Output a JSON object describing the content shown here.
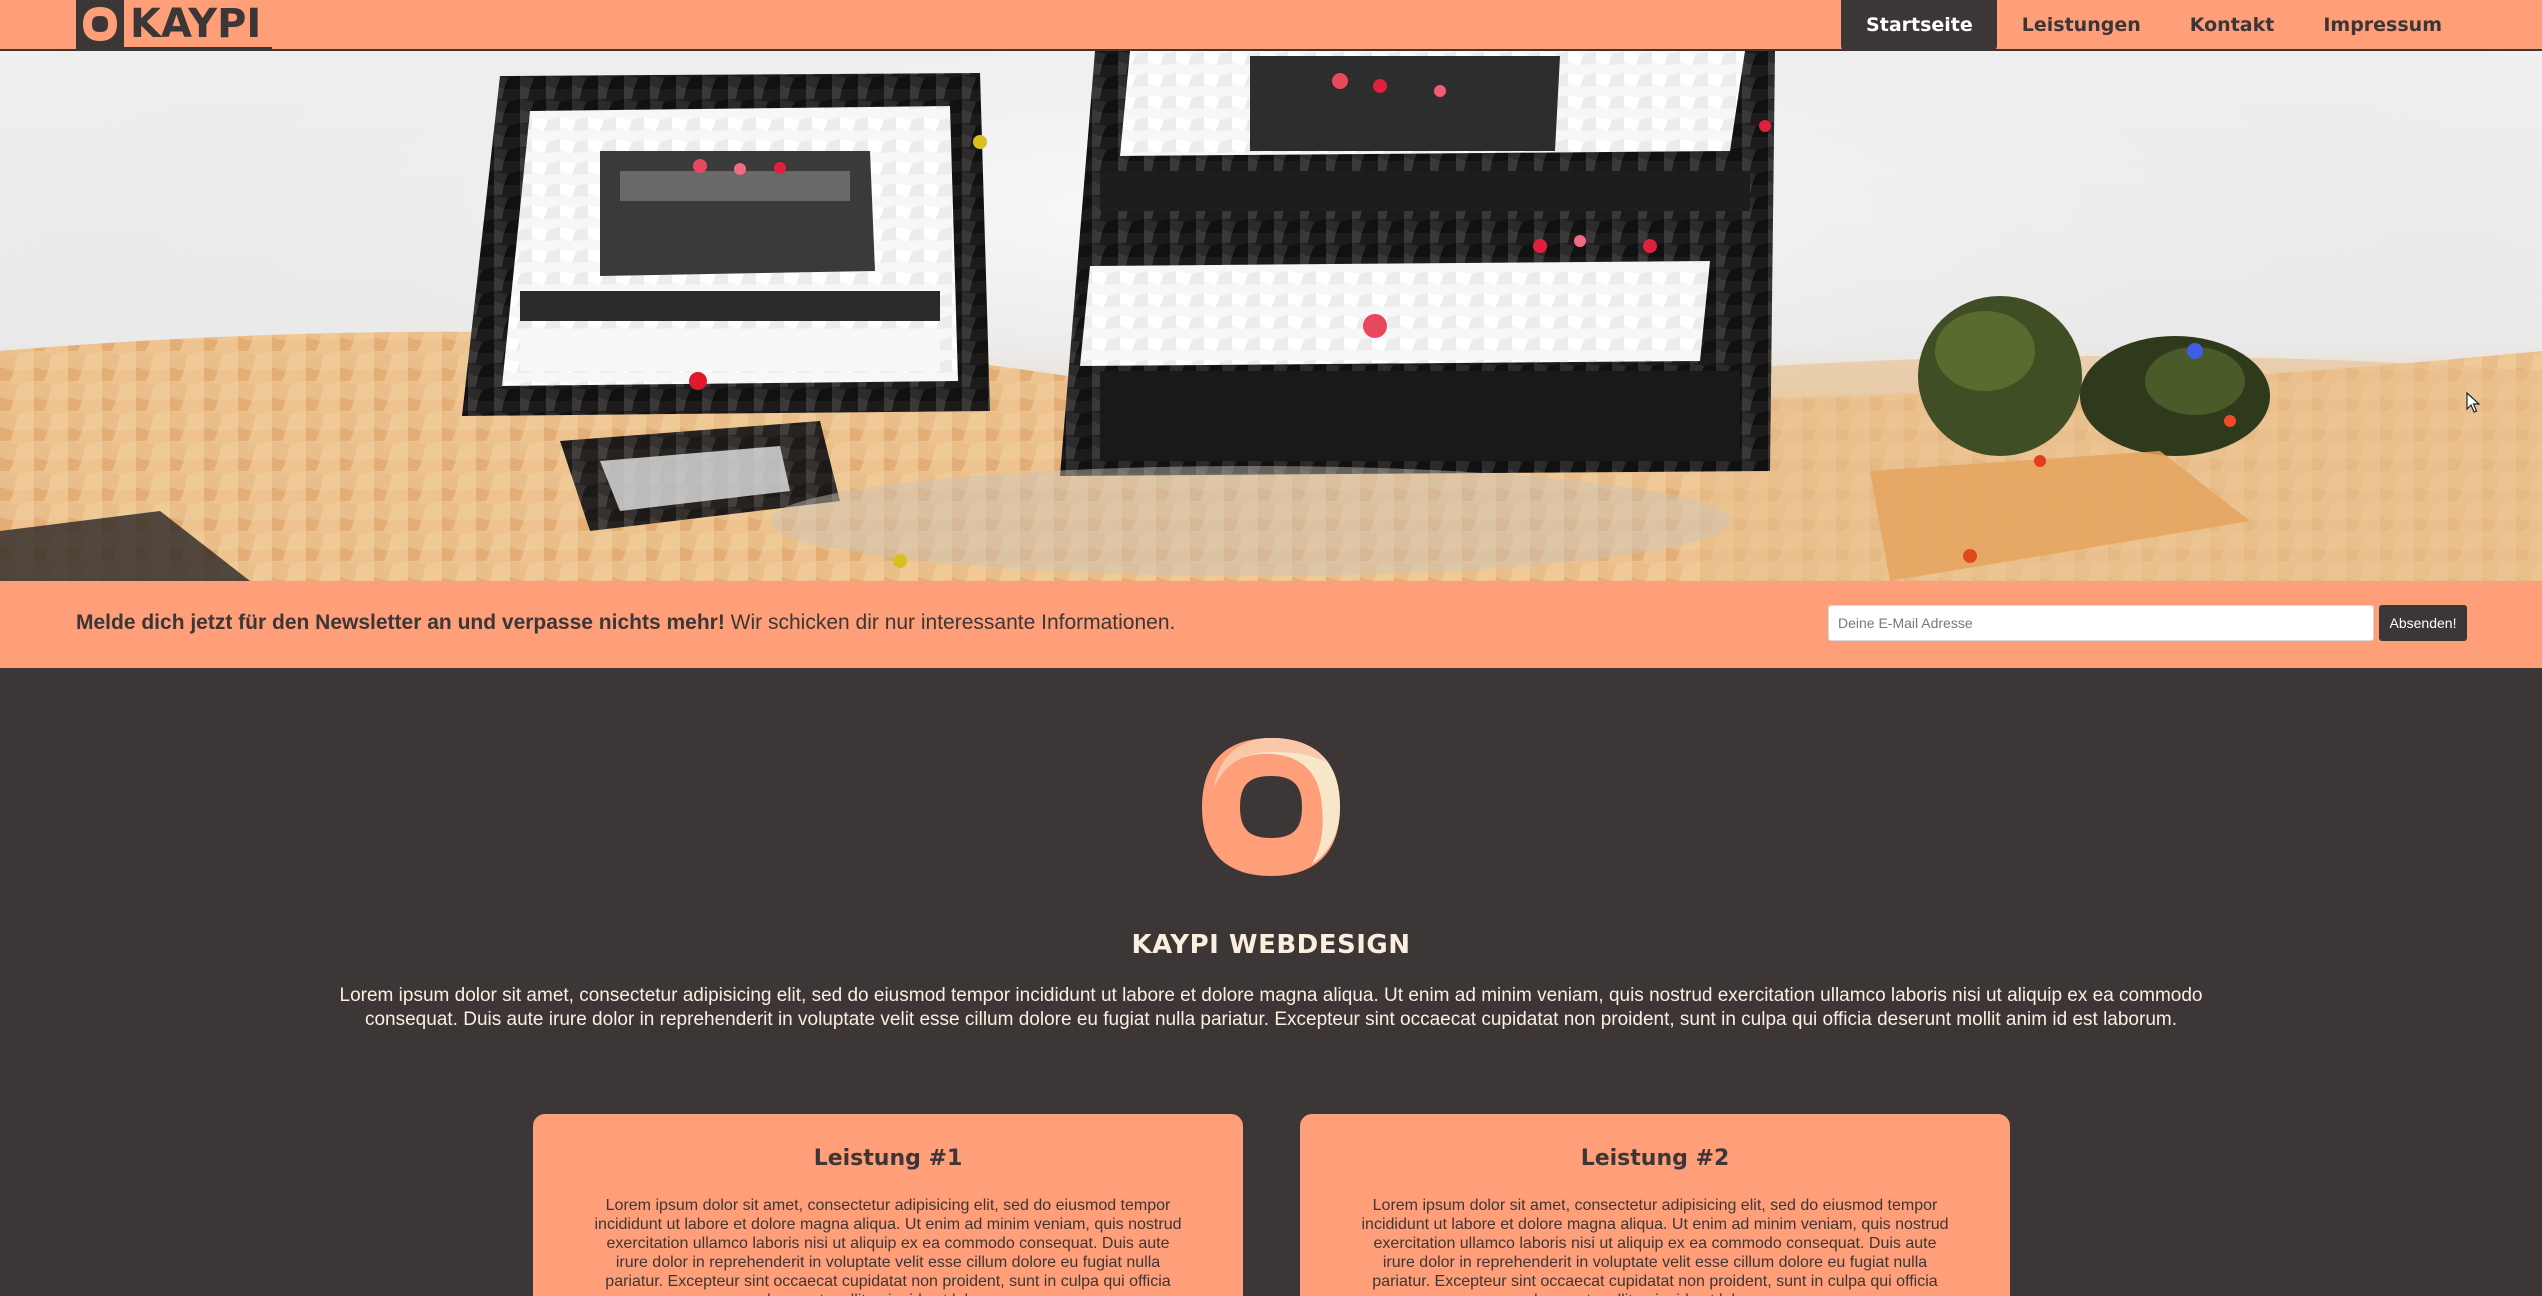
{
  "brand": {
    "name": "KAYPI"
  },
  "nav": {
    "items": [
      {
        "label": "Startseite",
        "active": true
      },
      {
        "label": "Leistungen",
        "active": false
      },
      {
        "label": "Kontakt",
        "active": false
      },
      {
        "label": "Impressum",
        "active": false
      }
    ]
  },
  "hero": {
    "image": "mosaic-desk-with-monitors-and-plants"
  },
  "newsletter": {
    "headline": "Melde dich jetzt für den Newsletter an und verpasse nichts mehr!",
    "subline": "Wir schicken dir nur interessante Informationen.",
    "input_placeholder": "Deine E-Mail Adresse",
    "input_value": "",
    "button_label": "Absenden!"
  },
  "main": {
    "title": "KAYPI WEBDESIGN",
    "text": "Lorem ipsum dolor sit amet, consectetur adipisicing elit, sed do eiusmod tempor incididunt ut labore et dolore magna aliqua. Ut enim ad minim veniam, quis nostrud exercitation ullamco laboris nisi ut aliquip ex ea commodo consequat. Duis aute irure dolor in reprehenderit in voluptate velit esse cillum dolore eu fugiat nulla pariatur. Excepteur sint occaecat cupidatat non proident, sunt in culpa qui officia deserunt mollit anim id est laborum.",
    "cards": [
      {
        "title": "Leistung #1",
        "text": "Lorem ipsum dolor sit amet, consectetur adipisicing elit, sed do eiusmod tempor incididunt ut labore et dolore magna aliqua. Ut enim ad minim veniam, quis nostrud exercitation ullamco laboris nisi ut aliquip ex ea commodo consequat. Duis aute irure dolor in reprehenderit in voluptate velit esse cillum dolore eu fugiat nulla pariatur. Excepteur sint occaecat cupidatat non proident, sunt in culpa qui officia deserunt mollit anim id est laborum."
      },
      {
        "title": "Leistung #2",
        "text": "Lorem ipsum dolor sit amet, consectetur adipisicing elit, sed do eiusmod tempor incididunt ut labore et dolore magna aliqua. Ut enim ad minim veniam, quis nostrud exercitation ullamco laboris nisi ut aliquip ex ea commodo consequat. Duis aute irure dolor in reprehenderit in voluptate velit esse cillum dolore eu fugiat nulla pariatur. Excepteur sint occaecat cupidatat non proident, sunt in culpa qui officia deserunt mollit anim id est laborum."
      }
    ]
  },
  "colors": {
    "accent": "#fe9f7a",
    "dark": "#3d3636",
    "light_text": "#fbefe0"
  }
}
